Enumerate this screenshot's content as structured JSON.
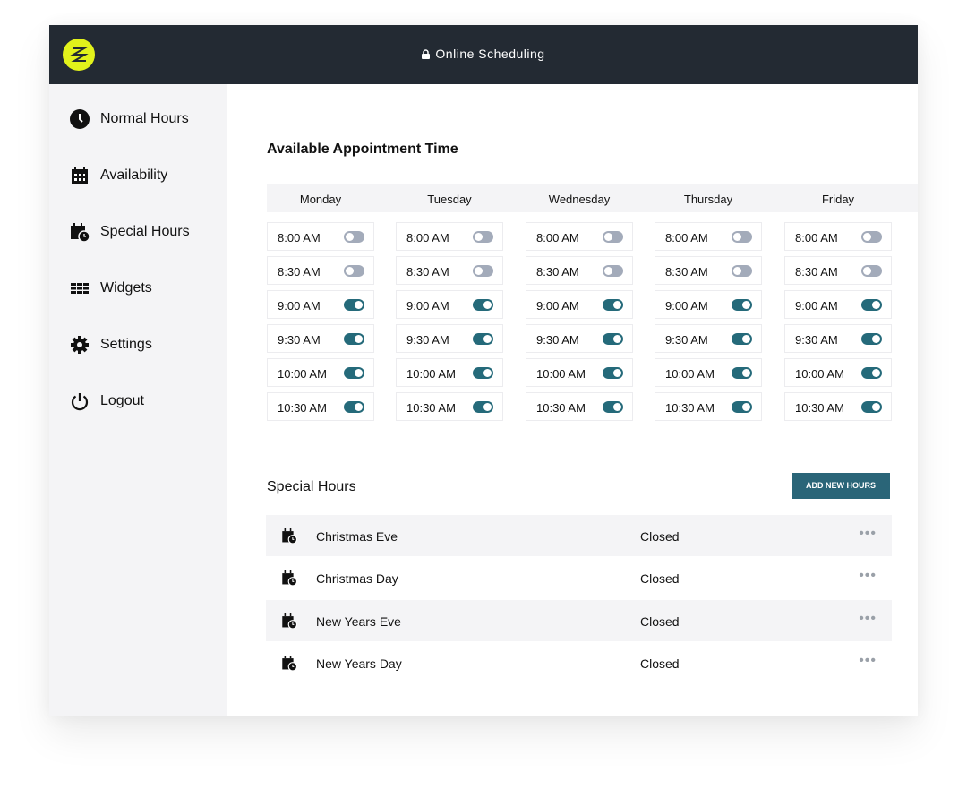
{
  "header": {
    "title": "Online Scheduling"
  },
  "sidebar": {
    "items": [
      {
        "label": "Normal Hours",
        "icon": "clock-icon"
      },
      {
        "label": "Availability",
        "icon": "calendar-icon"
      },
      {
        "label": "Special Hours",
        "icon": "calendar-clock-icon"
      },
      {
        "label": "Widgets",
        "icon": "grid-icon"
      },
      {
        "label": "Settings",
        "icon": "gear-icon"
      },
      {
        "label": "Logout",
        "icon": "power-icon"
      }
    ]
  },
  "availability": {
    "title": "Available Appointment Time",
    "days": [
      "Monday",
      "Tuesday",
      "Wednesday",
      "Thursday",
      "Friday"
    ],
    "slots": [
      {
        "time": "8:00 AM",
        "on": false
      },
      {
        "time": "8:30 AM",
        "on": false
      },
      {
        "time": "9:00 AM",
        "on": true
      },
      {
        "time": "9:30 AM",
        "on": true
      },
      {
        "time": "10:00 AM",
        "on": true
      },
      {
        "time": "10:30 AM",
        "on": true
      }
    ]
  },
  "special": {
    "title": "Special Hours",
    "add_label": "ADD NEW HOURS",
    "rows": [
      {
        "name": "Christmas Eve",
        "status": "Closed"
      },
      {
        "name": "Christmas Day",
        "status": "Closed"
      },
      {
        "name": "New Years Eve",
        "status": "Closed"
      },
      {
        "name": "New Years Day",
        "status": "Closed"
      }
    ]
  },
  "colors": {
    "header": "#232a33",
    "accent": "#256a7a",
    "logo": "#e2f21b"
  }
}
